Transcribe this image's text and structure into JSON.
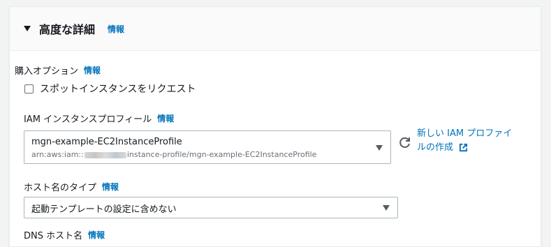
{
  "section": {
    "title": "高度な詳細",
    "info": "情報"
  },
  "purchase_option": {
    "label": "購入オプション",
    "info": "情報",
    "checkbox_label": "スポットインスタンスをリクエスト",
    "checked": false
  },
  "iam_profile": {
    "label": "IAM インスタンスプロフィール",
    "info": "情報",
    "selected_value": "mgn-example-EC2InstanceProfile",
    "arn_prefix": "arn:aws:iam::",
    "arn_suffix": "instance-profile/mgn-example-EC2InstanceProfile",
    "create_link_line1": "新しい IAM プロファイ",
    "create_link_line2": "ルの作成"
  },
  "hostname_type": {
    "label": "ホスト名のタイプ",
    "info": "情報",
    "selected_value": "起動テンプレートの設定に含めない"
  },
  "dns_hostname": {
    "label": "DNS ホスト名",
    "info": "情報"
  },
  "colors": {
    "link": "#0073bb",
    "text": "#16191f",
    "border": "#aab7b8",
    "muted": "#687078"
  },
  "icons": {
    "expand": "caret-down-icon",
    "dropdown": "caret-down-icon",
    "refresh": "refresh-icon",
    "external": "external-link-icon"
  }
}
